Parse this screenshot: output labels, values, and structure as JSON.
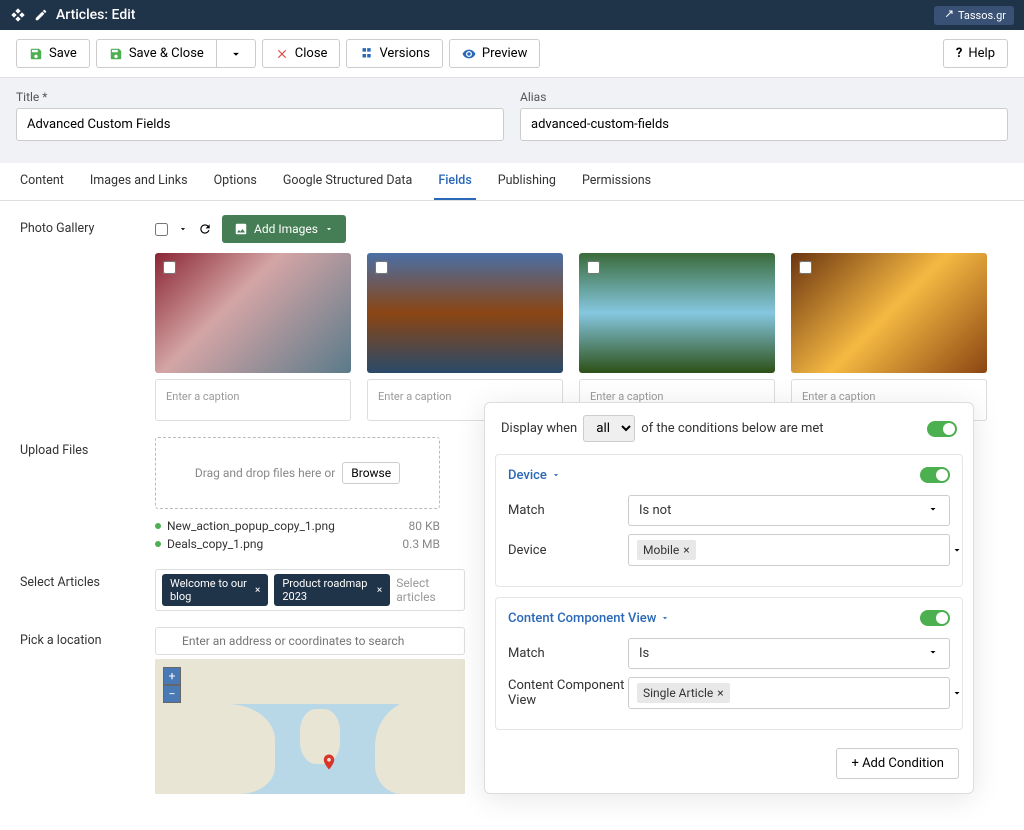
{
  "topbar": {
    "title": "Articles: Edit",
    "badge": "Tassos.gr"
  },
  "toolbar": {
    "save": "Save",
    "save_close": "Save & Close",
    "close": "Close",
    "versions": "Versions",
    "preview": "Preview",
    "help": "Help"
  },
  "form": {
    "title_label": "Title *",
    "title_value": "Advanced Custom Fields",
    "alias_label": "Alias",
    "alias_value": "advanced-custom-fields"
  },
  "tabs": [
    "Content",
    "Images and Links",
    "Options",
    "Google Structured Data",
    "Fields",
    "Publishing",
    "Permissions"
  ],
  "active_tab": "Fields",
  "gallery": {
    "label": "Photo Gallery",
    "add_button": "Add Images",
    "caption_placeholder": "Enter a caption"
  },
  "upload": {
    "label": "Upload Files",
    "drop_text": "Drag and drop files here or",
    "browse": "Browse",
    "files": [
      {
        "name": "New_action_popup_copy_1.png",
        "size": "80 KB"
      },
      {
        "name": "Deals_copy_1.png",
        "size": "0.3 MB"
      }
    ]
  },
  "articles": {
    "label": "Select Articles",
    "tags": [
      "Welcome to our blog",
      "Product roadmap 2023"
    ],
    "placeholder": "Select articles"
  },
  "location": {
    "label": "Pick a location",
    "placeholder": "Enter an address or coordinates to search"
  },
  "conditions": {
    "display_when": "Display when",
    "select_value": "all",
    "of_text": "of the conditions below are met",
    "blocks": [
      {
        "title": "Device",
        "rows": [
          {
            "label": "Match",
            "type": "select",
            "value": "Is not"
          },
          {
            "label": "Device",
            "type": "chip",
            "value": "Mobile"
          }
        ]
      },
      {
        "title": "Content Component View",
        "rows": [
          {
            "label": "Match",
            "type": "select",
            "value": "Is"
          },
          {
            "label": "Content Component View",
            "type": "chip",
            "value": "Single Article"
          }
        ]
      }
    ],
    "add_button": "Add Condition"
  }
}
